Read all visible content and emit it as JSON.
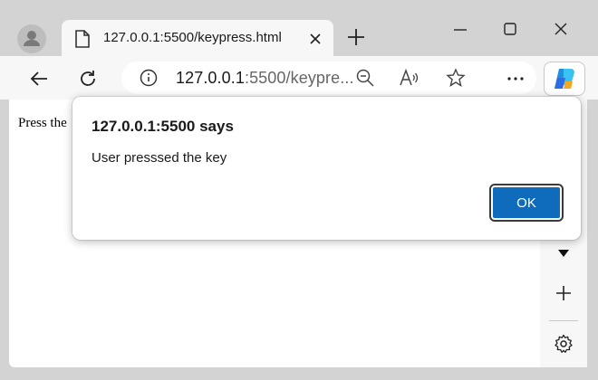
{
  "browser": {
    "tab": {
      "title": "127.0.0.1:5500/keypress.html"
    },
    "address_bar": {
      "host": "127.0.0.1",
      "path": ":5500/keypre..."
    }
  },
  "page": {
    "text": "Press the"
  },
  "dialog": {
    "title": "127.0.0.1:5500 says",
    "message": "User presssed the key",
    "ok_label": "OK"
  },
  "icons": {
    "profile": "profile-icon",
    "page": "page-icon",
    "close_tab": "close-icon",
    "new_tab": "plus-icon",
    "minimize": "minimize-icon",
    "maximize": "maximize-icon",
    "close_window": "close-icon",
    "back": "back-arrow-icon",
    "refresh": "refresh-icon",
    "info": "info-icon",
    "zoom": "zoom-out-icon",
    "read_aloud": "read-aloud-icon",
    "favorite": "star-icon",
    "more": "ellipsis-icon",
    "copilot": "copilot-icon",
    "sidebar_dropdown": "caret-down-icon",
    "sidebar_add": "plus-icon",
    "sidebar_settings": "gear-icon"
  },
  "colors": {
    "accent": "#0f6cbd",
    "toolbar": "#f7f7f7",
    "frame": "#d3d3d3"
  }
}
